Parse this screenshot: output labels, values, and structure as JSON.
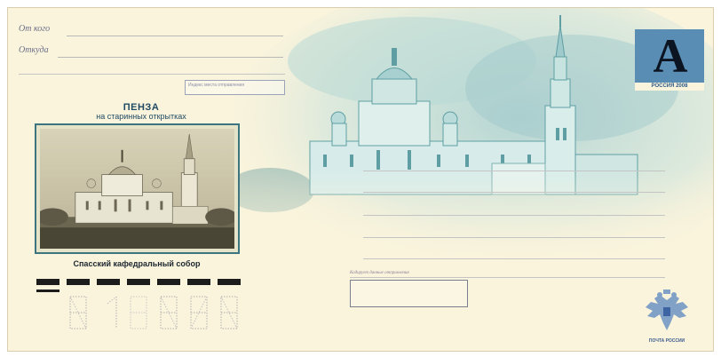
{
  "sender": {
    "from_label": "От кого",
    "where_label": "Откуда"
  },
  "small_box_text": "Индекс места отправления",
  "title": {
    "main": "ПЕНЗА",
    "sub": "на старинных открытках"
  },
  "caption": "Спасский кафедральный собор",
  "stamp": {
    "letter": "A",
    "country": "РОССИЯ  2008",
    "background_color": "#5a8db3"
  },
  "barcode_label": "Кодирует данные отправления",
  "emblem_text": "ПОЧТА РОССИИ",
  "colors": {
    "paper": "#fbf4dc",
    "frame": "#3c7480",
    "teal": "#4f9aa5"
  }
}
